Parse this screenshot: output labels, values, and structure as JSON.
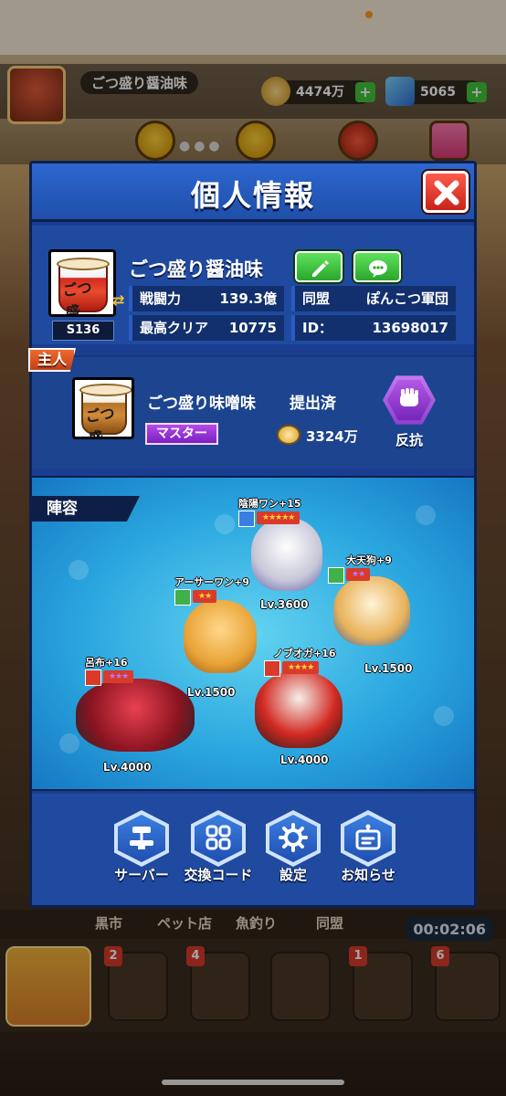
{
  "background": {
    "player_name": "ごつ盛り醤油味",
    "gold": "4474万",
    "gems": "5065",
    "bottom_menu": [
      "黒市",
      "ペット店",
      "魚釣り",
      "同盟"
    ],
    "timer": "00:02:06",
    "nav_badges": [
      "2",
      "4",
      "1",
      "6"
    ]
  },
  "dialog": {
    "title": "個人情報",
    "profile": {
      "name": "ごつ盛り醤油味",
      "server": "S136",
      "avatar_text": "ごつ盛",
      "stats": {
        "power_label": "戦闘力",
        "power_value": "139.3億",
        "alliance_label": "同盟",
        "alliance_value": "ぽんこつ軍団",
        "clear_label": "最高クリア",
        "clear_value": "10775",
        "id_label": "ID：",
        "id_value": "13698017"
      }
    },
    "master": {
      "tag": "主人",
      "name": "ごつ盛り味噌味",
      "status": "提出済",
      "role": "マスター",
      "gold": "3324万",
      "revolt_label": "反抗"
    },
    "formation": {
      "tag": "陣容",
      "units": [
        {
          "name": "陰陽ワン+15",
          "level": "Lv.3600",
          "color": "#d7d7e0"
        },
        {
          "name": "アーサーワン+9",
          "level": "Lv.1500",
          "color": "#e9b44a"
        },
        {
          "name": "大天狗+9",
          "level": "Lv.1500",
          "color": "#f0d9b0"
        },
        {
          "name": "呂布+16",
          "level": "Lv.4000",
          "color": "#b1282f"
        },
        {
          "name": "ノブオガ+16",
          "level": "Lv.4000",
          "color": "#3a3030"
        }
      ]
    },
    "actions": [
      {
        "label": "サーバー",
        "icon": "server-icon"
      },
      {
        "label": "交換コード",
        "icon": "grid-icon"
      },
      {
        "label": "設定",
        "icon": "gear-icon"
      },
      {
        "label": "お知らせ",
        "icon": "notice-icon"
      }
    ]
  }
}
